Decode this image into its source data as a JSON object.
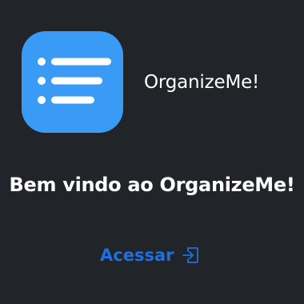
{
  "header": {
    "logo_icon": "list-icon",
    "app_name": "OrganizeMe!"
  },
  "main": {
    "welcome_text": "Bem vindo ao OrganizeMe!",
    "access_label": "Acessar",
    "access_icon": "sign-in-icon"
  },
  "colors": {
    "background": "#212529",
    "logo_bg": "#3a9bf6",
    "link": "#1f6fe0",
    "text": "#ffffff"
  }
}
